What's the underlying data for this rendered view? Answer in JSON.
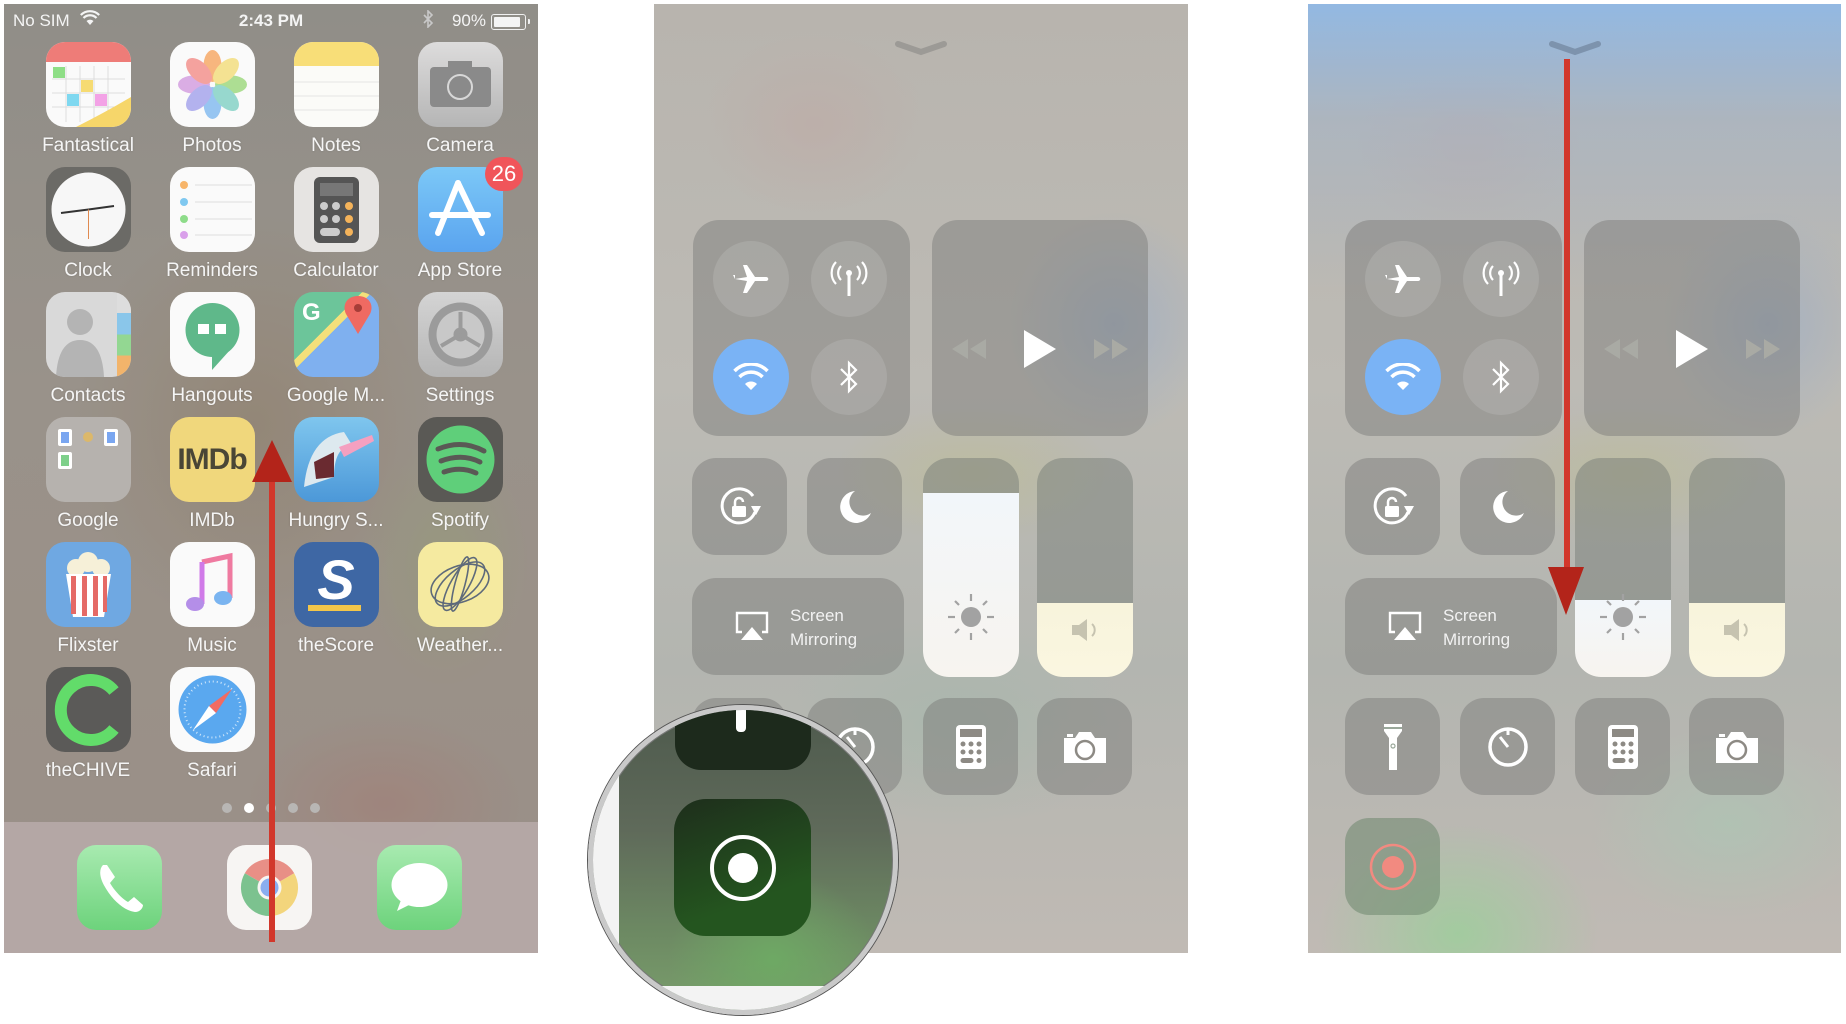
{
  "home_screen": {
    "status_bar": {
      "carrier": "No SIM",
      "time": "2:43 PM",
      "battery_percent": "90%",
      "battery_level": 0.9,
      "bluetooth_icon": "bluetooth-icon",
      "wifi_icon": "wifi-icon"
    },
    "apps": [
      {
        "label": "Fantastical",
        "icon": "fantastical-icon"
      },
      {
        "label": "Photos",
        "icon": "photos-icon"
      },
      {
        "label": "Notes",
        "icon": "notes-icon"
      },
      {
        "label": "Camera",
        "icon": "camera-icon"
      },
      {
        "label": "Clock",
        "icon": "clock-icon"
      },
      {
        "label": "Reminders",
        "icon": "reminders-icon"
      },
      {
        "label": "Calculator",
        "icon": "calculator-icon"
      },
      {
        "label": "App Store",
        "icon": "app-store-icon",
        "badge": "26"
      },
      {
        "label": "Contacts",
        "icon": "contacts-icon"
      },
      {
        "label": "Hangouts",
        "icon": "hangouts-icon"
      },
      {
        "label": "Google M...",
        "icon": "google-maps-icon"
      },
      {
        "label": "Settings",
        "icon": "settings-icon"
      },
      {
        "label": "Google",
        "icon": "google-folder-icon"
      },
      {
        "label": "IMDb",
        "icon": "imdb-icon",
        "glyph": "IMDb"
      },
      {
        "label": "Hungry S...",
        "icon": "hungry-shark-icon"
      },
      {
        "label": "Spotify",
        "icon": "spotify-icon"
      },
      {
        "label": "Flixster",
        "icon": "flixster-icon"
      },
      {
        "label": "Music",
        "icon": "music-icon"
      },
      {
        "label": "theScore",
        "icon": "thescore-icon",
        "glyph": "S"
      },
      {
        "label": "Weather...",
        "icon": "weather-icon"
      },
      {
        "label": "theCHIVE",
        "icon": "thechive-icon",
        "glyph": "C"
      },
      {
        "label": "Safari",
        "icon": "safari-icon"
      }
    ],
    "page_dots": {
      "count": 5,
      "active_index": 1
    },
    "dock": [
      {
        "name": "Phone",
        "icon": "phone-icon"
      },
      {
        "name": "Chrome",
        "icon": "chrome-icon"
      },
      {
        "name": "Messages",
        "icon": "messages-icon"
      }
    ],
    "gesture_annotation": {
      "direction": "up",
      "color": "#c0271d"
    }
  },
  "control_center_magnified": {
    "connectivity": [
      {
        "name": "Airplane Mode",
        "icon": "airplane-icon",
        "on": false
      },
      {
        "name": "Cellular Data",
        "icon": "cellular-antenna-icon",
        "on": false
      },
      {
        "name": "Wi-Fi",
        "icon": "wifi-icon",
        "on": true
      },
      {
        "name": "Bluetooth",
        "icon": "bluetooth-icon",
        "on": false
      }
    ],
    "media": {
      "rewind": "rewind-icon",
      "play": "play-icon",
      "forward": "fast-forward-icon"
    },
    "toggles": [
      {
        "name": "Orientation Lock",
        "icon": "rotation-lock-icon"
      },
      {
        "name": "Do Not Disturb",
        "icon": "moon-icon"
      }
    ],
    "screen_mirroring": {
      "line1": "Screen",
      "line2": "Mirroring"
    },
    "brightness_level": 0.84,
    "volume_level": 0.34,
    "bottom_tiles": [
      {
        "name": "Timer",
        "icon": "timer-icon"
      },
      {
        "name": "Calculator",
        "icon": "calculator-icon"
      },
      {
        "name": "Camera",
        "icon": "camera-icon"
      }
    ],
    "magnified_control": {
      "name": "Screen Recording",
      "icon": "screen-record-icon",
      "accent": "#24551f"
    }
  },
  "control_center_full": {
    "connectivity": [
      {
        "name": "Airplane Mode",
        "icon": "airplane-icon",
        "on": false
      },
      {
        "name": "Cellular Data",
        "icon": "cellular-antenna-icon",
        "on": false
      },
      {
        "name": "Wi-Fi",
        "icon": "wifi-icon",
        "on": true
      },
      {
        "name": "Bluetooth",
        "icon": "bluetooth-icon",
        "on": false
      }
    ],
    "screen_mirroring": {
      "line1": "Screen",
      "line2": "Mirroring"
    },
    "brightness_level": 0.35,
    "volume_level": 0.34,
    "bottom_tiles": [
      {
        "name": "Flashlight",
        "icon": "flashlight-icon"
      },
      {
        "name": "Timer",
        "icon": "timer-icon"
      },
      {
        "name": "Calculator",
        "icon": "calculator-icon"
      },
      {
        "name": "Camera",
        "icon": "camera-icon"
      }
    ],
    "screen_recording": {
      "name": "Screen Recording",
      "icon": "screen-record-icon",
      "accent": "#f28a80"
    },
    "gesture_annotation": {
      "direction": "down",
      "color": "#c0271d"
    }
  }
}
